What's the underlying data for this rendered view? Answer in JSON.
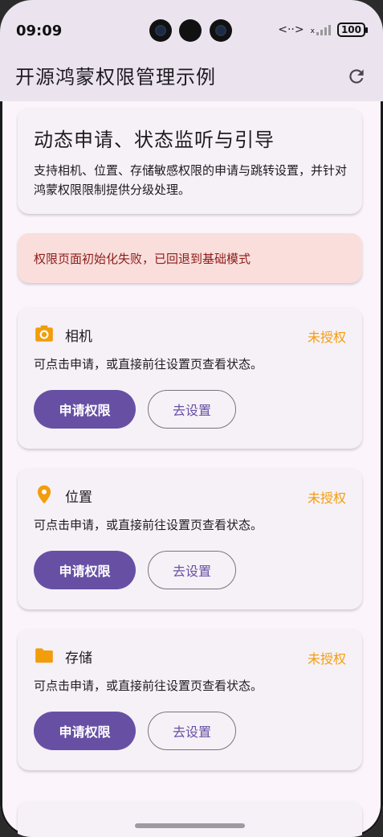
{
  "status_bar": {
    "time": "09:09",
    "network_symbol": "<··>",
    "signal_label": "x",
    "battery": "100"
  },
  "app_bar": {
    "title": "开源鸿蒙权限管理示例",
    "refresh_icon": "refresh-icon"
  },
  "intro": {
    "title": "动态申请、状态监听与引导",
    "description": "支持相机、位置、存储敏感权限的申请与跳转设置，并针对鸿蒙权限限制提供分级处理。"
  },
  "error_banner": {
    "text": "权限页面初始化失败，已回退到基础模式",
    "background": "#f9dedc",
    "text_color": "#8c1d18"
  },
  "permissions": [
    {
      "icon": "camera-icon",
      "name": "相机",
      "status": "未授权",
      "description": "可点击申请，或直接前往设置页查看状态。",
      "request_label": "申请权限",
      "settings_label": "去设置"
    },
    {
      "icon": "location-icon",
      "name": "位置",
      "status": "未授权",
      "description": "可点击申请，或直接前往设置页查看状态。",
      "request_label": "申请权限",
      "settings_label": "去设置"
    },
    {
      "icon": "folder-icon",
      "name": "存储",
      "status": "未授权",
      "description": "可点击申请，或直接前往设置页查看状态。",
      "request_label": "申请权限",
      "settings_label": "去设置"
    }
  ],
  "colors": {
    "primary": "#6750a4",
    "status_warning": "#f29d0b",
    "icon_orange": "#f29d0b",
    "app_bar_bg": "#ebe4ef"
  }
}
